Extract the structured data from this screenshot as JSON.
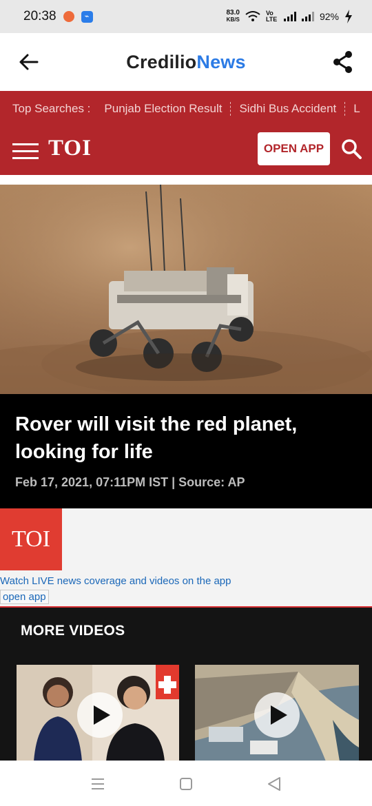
{
  "status_bar": {
    "time": "20:38",
    "net_speed_value": "83.0",
    "net_speed_unit": "KB/S",
    "volte": "Vo LTE",
    "battery": "92%",
    "icons": [
      "notification-app-icon",
      "usb-icon",
      "wifi-icon",
      "signal-icon",
      "battery-charging-icon"
    ]
  },
  "header": {
    "brand_part1": "Credilio",
    "brand_part2": "News",
    "back_icon": "back-arrow-icon",
    "share_icon": "share-icon",
    "brand_accent_color": "#2c7be5"
  },
  "top_searches": {
    "label": "Top Searches :",
    "items": [
      "Punjab Election Result",
      "Sidhi Bus Accident",
      "L"
    ]
  },
  "toi_nav": {
    "logo": "TOI",
    "open_app": "OPEN APP",
    "menu_icon": "hamburger-menu-icon",
    "search_icon": "search-icon",
    "brand_color": "#b2262b"
  },
  "video": {
    "headline": "Rover will visit the red planet, looking for life",
    "meta": "Feb 17, 2021, 07:11PM IST | Source: AP"
  },
  "promo": {
    "logo": "TOI",
    "text": "Watch LIVE news coverage and videos on the app",
    "button": "open app"
  },
  "more_videos": {
    "title": "MORE VIDEOS",
    "items": [
      {
        "thumb": "people-podcast-thumbnail",
        "icon": "play-icon"
      },
      {
        "thumb": "coastline-aerial-thumbnail",
        "icon": "play-icon"
      }
    ]
  },
  "navbar": {
    "icons": [
      "recent-apps-icon",
      "home-icon",
      "back-icon"
    ]
  }
}
